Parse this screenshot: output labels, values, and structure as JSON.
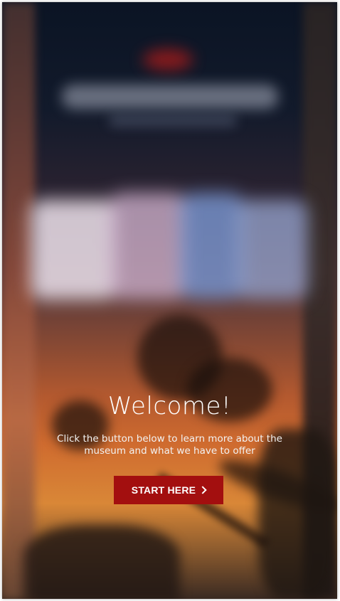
{
  "welcome": {
    "title": "Welcome!",
    "subtitle": "Click the button below to learn more about the museum and what we have to offer",
    "start_button": "START HERE"
  },
  "colors": {
    "button": "#a30f0f",
    "text": "#ffffff"
  },
  "icons": {
    "start_button_icon": "chevron-right-icon"
  }
}
